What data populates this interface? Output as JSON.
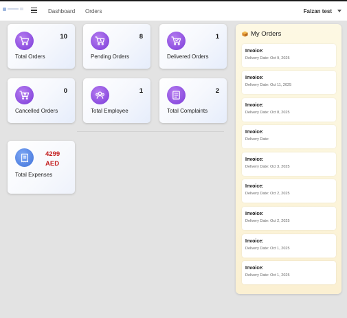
{
  "nav": {
    "links": [
      "Dashboard",
      "Orders"
    ],
    "user_name": "Faizan test"
  },
  "stats": [
    {
      "label": "Total Orders",
      "value": "10",
      "icon": "cart-icon"
    },
    {
      "label": "Pending Orders",
      "value": "8",
      "icon": "pending-cart-icon"
    },
    {
      "label": "Delivered Orders",
      "value": "1",
      "icon": "delivered-cart-icon"
    },
    {
      "label": "Cancelled Orders",
      "value": "0",
      "icon": "cancelled-cart-icon"
    },
    {
      "label": "Total Employee",
      "value": "1",
      "icon": "users-icon"
    },
    {
      "label": "Total Complaints",
      "value": "2",
      "icon": "complaint-icon"
    }
  ],
  "expenses": {
    "label": "Total Expenses",
    "amount": "4299 AED",
    "amount_color": "#c42020",
    "icon": "receipt-icon"
  },
  "my_orders": {
    "title": "My Orders",
    "icon": "box-icon",
    "items": [
      {
        "invoice": "Invoice:",
        "delivery": "Delivery Date: Oct 9, 2025"
      },
      {
        "invoice": "Invoice:",
        "delivery": "Delivery Date: Oct 11, 2025"
      },
      {
        "invoice": "Invoice:",
        "delivery": "Delivery Date: Oct 8, 2025"
      },
      {
        "invoice": "Invoice:",
        "delivery": "Delivery Date:"
      },
      {
        "invoice": "Invoice:",
        "delivery": "Delivery Date: Oct 3, 2025"
      },
      {
        "invoice": "Invoice:",
        "delivery": "Delivery Date: Oct 2, 2025"
      },
      {
        "invoice": "Invoice:",
        "delivery": "Delivery Date: Oct 2, 2025"
      },
      {
        "invoice": "Invoice:",
        "delivery": "Delivery Date: Oct 1, 2025"
      },
      {
        "invoice": "Invoice:",
        "delivery": "Delivery Date: Oct 1, 2025"
      }
    ]
  },
  "colors": {
    "icon_purple": "#8a4ce0",
    "icon_blue": "#4f80e0",
    "orders_panel_bg": "#fcf6dd"
  }
}
